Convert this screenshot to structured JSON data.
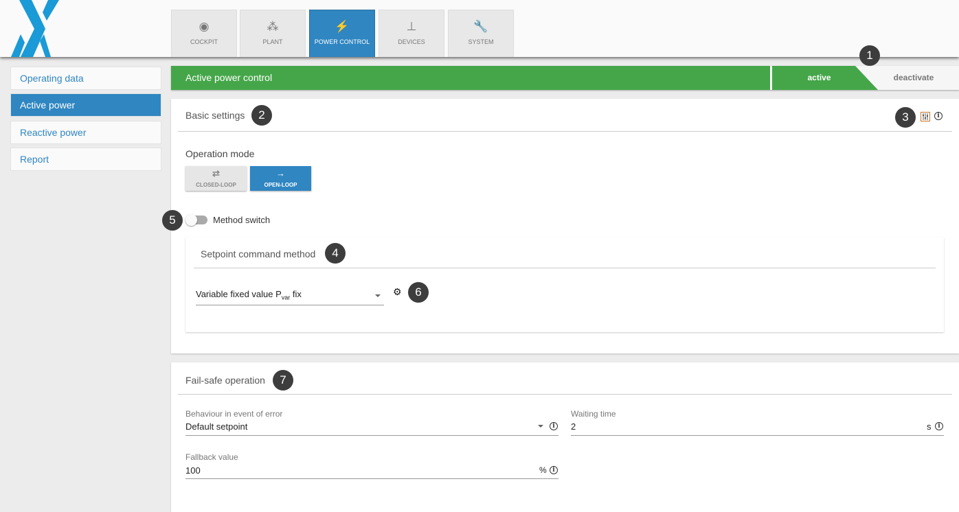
{
  "colors": {
    "brand": "#1a9ad6",
    "accent": "#2f86c1",
    "active_green": "#45a649"
  },
  "nav": {
    "tabs": [
      {
        "label": "COCKPIT",
        "icon": "target-icon"
      },
      {
        "label": "PLANT",
        "icon": "network-icon"
      },
      {
        "label": "POWER CONTROL",
        "icon": "power-tower-icon",
        "active": true
      },
      {
        "label": "DEVICES",
        "icon": "hierarchy-icon"
      },
      {
        "label": "SYSTEM",
        "icon": "wrench-icon"
      }
    ]
  },
  "sidebar": {
    "items": [
      {
        "label": "Operating data"
      },
      {
        "label": "Active power",
        "active": true
      },
      {
        "label": "Reactive power"
      },
      {
        "label": "Report"
      }
    ]
  },
  "status_bar": {
    "title": "Active power control",
    "active_label": "active",
    "deactivate_label": "deactivate"
  },
  "badges": [
    "1",
    "2",
    "3",
    "4",
    "5",
    "6",
    "7"
  ],
  "basic": {
    "title": "Basic settings",
    "operation_mode_label": "Operation mode",
    "closed_loop": "CLOSED-LOOP",
    "open_loop": "OPEN-LOOP",
    "selected_mode": "OPEN-LOOP",
    "method_switch_label": "Method switch",
    "method_switch_on": false
  },
  "setpoint": {
    "title": "Setpoint command method",
    "select_prefix": "Variable fixed value P",
    "select_sub": "var",
    "select_suffix": " fix"
  },
  "failsafe": {
    "title": "Fail-safe operation",
    "behaviour_label": "Behaviour in event of error",
    "behaviour_value": "Default setpoint",
    "waiting_label": "Waiting time",
    "waiting_value": "2",
    "waiting_unit": "s",
    "fallback_label": "Fallback value",
    "fallback_value": "100",
    "fallback_unit": "%"
  }
}
